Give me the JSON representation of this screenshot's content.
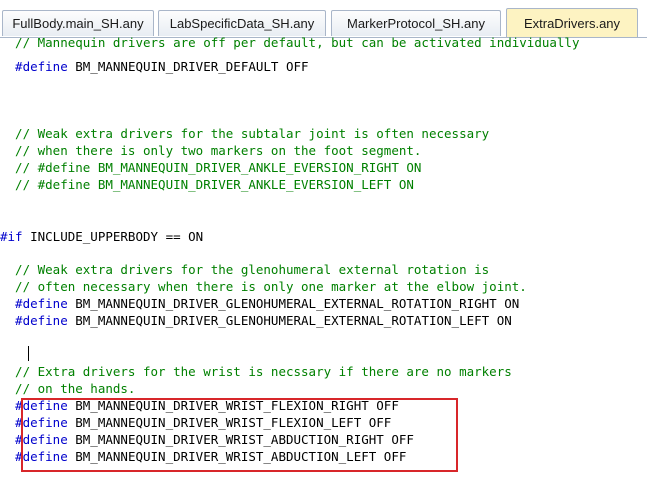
{
  "tabs": [
    {
      "label": "FullBody.main_SH.any",
      "active": false
    },
    {
      "label": "LabSpecificData_SH.any",
      "active": false
    },
    {
      "label": "MarkerProtocol_SH.any",
      "active": false
    },
    {
      "label": "ExtraDrivers.any",
      "active": true
    }
  ],
  "code": {
    "l1": "  // Mannequin drivers are off per default, but can be activated individually",
    "l2_kw": "  #define",
    "l2_rest": " BM_MANNEQUIN_DRIVER_DEFAULT OFF",
    "c1": "  // Weak extra drivers for the subtalar joint is often necessary",
    "c2": "  // when there is only two markers on the foot segment.",
    "c3": "  // #define BM_MANNEQUIN_DRIVER_ANKLE_EVERSION_RIGHT ON",
    "c4": "  // #define BM_MANNEQUIN_DRIVER_ANKLE_EVERSION_LEFT ON",
    "if_kw": "#if",
    "if_rest": " INCLUDE_UPPERBODY == ON",
    "g1": "  // Weak extra drivers for the glenohumeral external rotation is",
    "g2": "  // often necessary when there is only one marker at the elbow joint.",
    "d1_kw": "  #define",
    "d1_rest": " BM_MANNEQUIN_DRIVER_GLENOHUMERAL_EXTERNAL_ROTATION_RIGHT ON",
    "d2_kw": "  #define",
    "d2_rest": " BM_MANNEQUIN_DRIVER_GLENOHUMERAL_EXTERNAL_ROTATION_LEFT ON",
    "w1": "  // Extra drivers for the wrist is necssary if there are no markers",
    "w2": "  // on the hands.",
    "wd1_kw": "  #define",
    "wd1_rest": " BM_MANNEQUIN_DRIVER_WRIST_FLEXION_RIGHT OFF",
    "wd2_kw": "  #define",
    "wd2_rest": " BM_MANNEQUIN_DRIVER_WRIST_FLEXION_LEFT OFF",
    "wd3_kw": "  #define",
    "wd3_rest": " BM_MANNEQUIN_DRIVER_WRIST_ABDUCTION_RIGHT OFF",
    "wd4_kw": "  #define",
    "wd4_rest": " BM_MANNEQUIN_DRIVER_WRIST_ABDUCTION_LEFT OFF"
  },
  "colors": {
    "comment": "#008000",
    "keyword": "#0000cc",
    "highlight_box": "#d8262a",
    "active_tab": "#fdf3c2"
  }
}
